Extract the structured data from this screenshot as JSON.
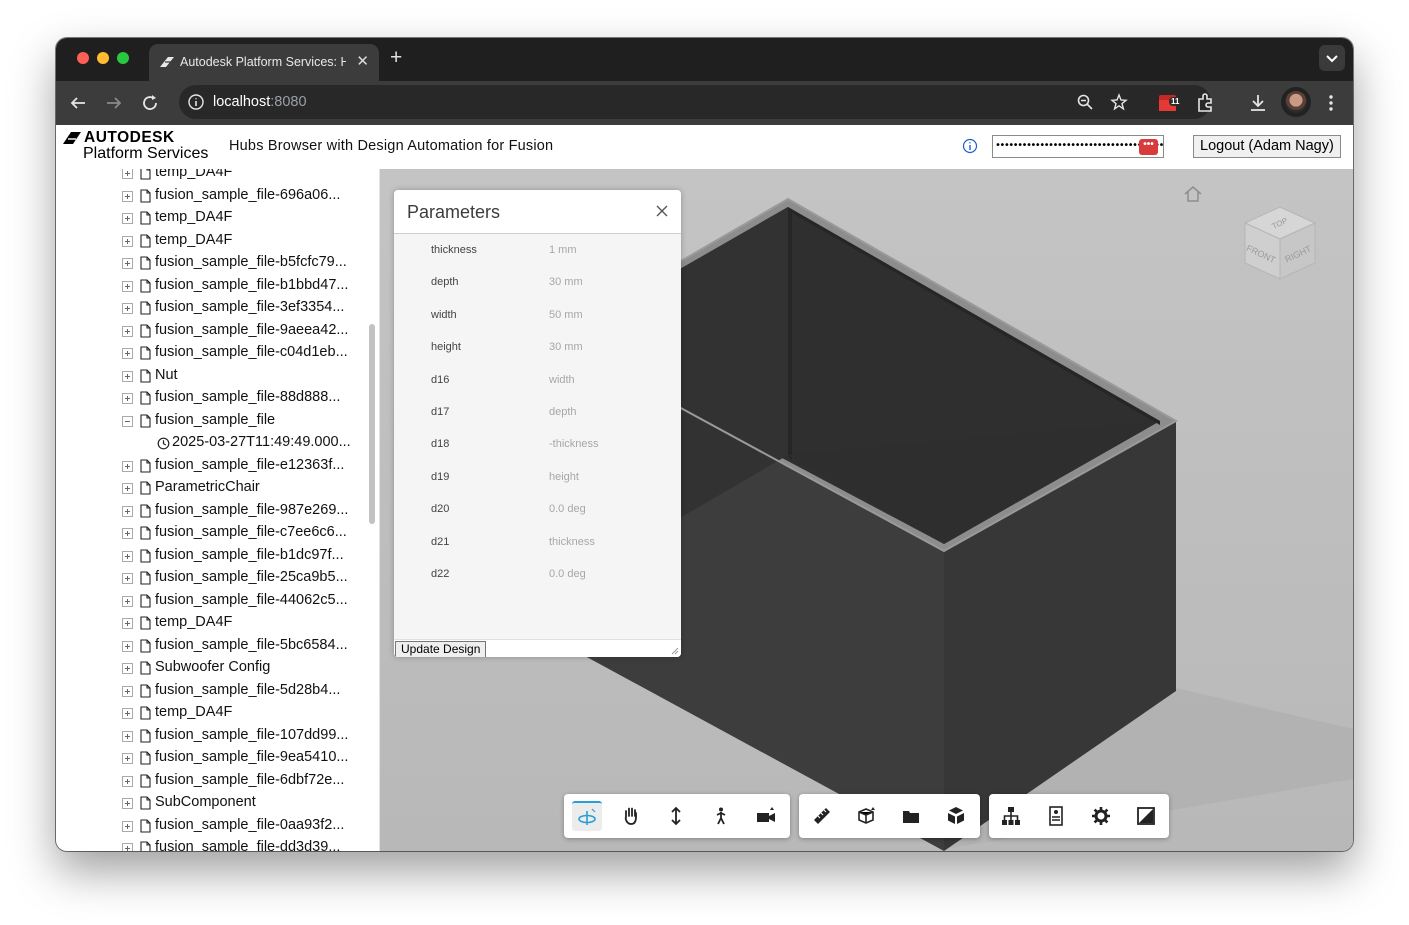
{
  "browser": {
    "tab_title": "Autodesk Platform Services: Hubs Browser",
    "tab_close": "✕",
    "new_tab": "+",
    "url_host": "localhost",
    "url_port": ":8080",
    "extension_badge": "11"
  },
  "header": {
    "logo_top": "AUTODESK",
    "logo_bottom": "Platform Services",
    "title": "Hubs Browser with Design Automation for Fusion",
    "token_value": "••••••••••••••••••••••••••••••••••••••••••••••",
    "password_key": "•••",
    "logout_label": "Logout (Adam Nagy)"
  },
  "tree": {
    "items": [
      {
        "label": "temp_DA4F",
        "type": "file",
        "expanded": false
      },
      {
        "label": "fusion_sample_file-696a06...",
        "type": "file",
        "expanded": false
      },
      {
        "label": "temp_DA4F",
        "type": "file",
        "expanded": false
      },
      {
        "label": "temp_DA4F",
        "type": "file",
        "expanded": false
      },
      {
        "label": "fusion_sample_file-b5fcfc79...",
        "type": "file",
        "expanded": false
      },
      {
        "label": "fusion_sample_file-b1bbd47...",
        "type": "file",
        "expanded": false
      },
      {
        "label": "fusion_sample_file-3ef3354...",
        "type": "file",
        "expanded": false
      },
      {
        "label": "fusion_sample_file-9aeea42...",
        "type": "file",
        "expanded": false
      },
      {
        "label": "fusion_sample_file-c04d1eb...",
        "type": "file",
        "expanded": false
      },
      {
        "label": "Nut",
        "type": "file",
        "expanded": false
      },
      {
        "label": "fusion_sample_file-88d888...",
        "type": "file",
        "expanded": false
      },
      {
        "label": "fusion_sample_file",
        "type": "file",
        "expanded": true
      },
      {
        "label": "2025-03-27T11:49:49.000...",
        "type": "version",
        "expanded": false
      },
      {
        "label": "fusion_sample_file-e12363f...",
        "type": "file",
        "expanded": false
      },
      {
        "label": "ParametricChair",
        "type": "file",
        "expanded": false
      },
      {
        "label": "fusion_sample_file-987e269...",
        "type": "file",
        "expanded": false
      },
      {
        "label": "fusion_sample_file-c7ee6c6...",
        "type": "file",
        "expanded": false
      },
      {
        "label": "fusion_sample_file-b1dc97f...",
        "type": "file",
        "expanded": false
      },
      {
        "label": "fusion_sample_file-25ca9b5...",
        "type": "file",
        "expanded": false
      },
      {
        "label": "fusion_sample_file-44062c5...",
        "type": "file",
        "expanded": false
      },
      {
        "label": "temp_DA4F",
        "type": "file",
        "expanded": false
      },
      {
        "label": "fusion_sample_file-5bc6584...",
        "type": "file",
        "expanded": false
      },
      {
        "label": "Subwoofer Config",
        "type": "file",
        "expanded": false
      },
      {
        "label": "fusion_sample_file-5d28b4...",
        "type": "file",
        "expanded": false
      },
      {
        "label": "temp_DA4F",
        "type": "file",
        "expanded": false
      },
      {
        "label": "fusion_sample_file-107dd99...",
        "type": "file",
        "expanded": false
      },
      {
        "label": "fusion_sample_file-9ea5410...",
        "type": "file",
        "expanded": false
      },
      {
        "label": "fusion_sample_file-6dbf72e...",
        "type": "file",
        "expanded": false
      },
      {
        "label": "SubComponent",
        "type": "file",
        "expanded": false
      },
      {
        "label": "fusion_sample_file-0aa93f2...",
        "type": "file",
        "expanded": false
      },
      {
        "label": "fusion_sample_file-dd3d39...",
        "type": "file",
        "expanded": false
      }
    ]
  },
  "parameters": {
    "title": "Parameters",
    "rows": [
      {
        "name": "thickness",
        "value": "1 mm"
      },
      {
        "name": "depth",
        "value": "30 mm"
      },
      {
        "name": "width",
        "value": "50 mm"
      },
      {
        "name": "height",
        "value": "30 mm"
      },
      {
        "name": "d16",
        "value": "width"
      },
      {
        "name": "d17",
        "value": "depth"
      },
      {
        "name": "d18",
        "value": "-thickness"
      },
      {
        "name": "d19",
        "value": "height"
      },
      {
        "name": "d20",
        "value": "0.0 deg"
      },
      {
        "name": "d21",
        "value": "thickness"
      },
      {
        "name": "d22",
        "value": "0.0 deg"
      }
    ],
    "update_label": "Update Design"
  },
  "viewcube": {
    "top": "TOP",
    "front": "FRONT",
    "right": "RIGHT"
  },
  "viewer_tools": [
    {
      "name": "orbit-tool",
      "icon": "orbit-icon",
      "active": true
    },
    {
      "name": "pan-tool",
      "icon": "hand-icon",
      "active": false
    },
    {
      "name": "zoom-tool",
      "icon": "zoom-arrows-icon",
      "active": false
    },
    {
      "name": "first-person-tool",
      "icon": "person-icon",
      "active": false
    },
    {
      "name": "camera-tool",
      "icon": "camera-icon",
      "active": false
    },
    {
      "name": "measure-tool",
      "icon": "ruler-icon",
      "active": false
    },
    {
      "name": "section-tool",
      "icon": "section-box-icon",
      "active": false
    },
    {
      "name": "explode-tool",
      "icon": "folder-icon",
      "active": false
    },
    {
      "name": "model-browser-tool",
      "icon": "cube-explode-icon",
      "active": false
    },
    {
      "name": "structure-tool",
      "icon": "hierarchy-icon",
      "active": false
    },
    {
      "name": "properties-tool",
      "icon": "properties-icon",
      "active": false
    },
    {
      "name": "settings-tool",
      "icon": "gear-icon",
      "active": false
    },
    {
      "name": "fullscreen-tool",
      "icon": "fullscreen-icon",
      "active": false
    }
  ],
  "colors": {
    "accent": "#2a9fd6",
    "viewer_background": "#bdbdbd",
    "model_dark": "#3a3a3a",
    "tab_bar": "#1f1f1f"
  }
}
